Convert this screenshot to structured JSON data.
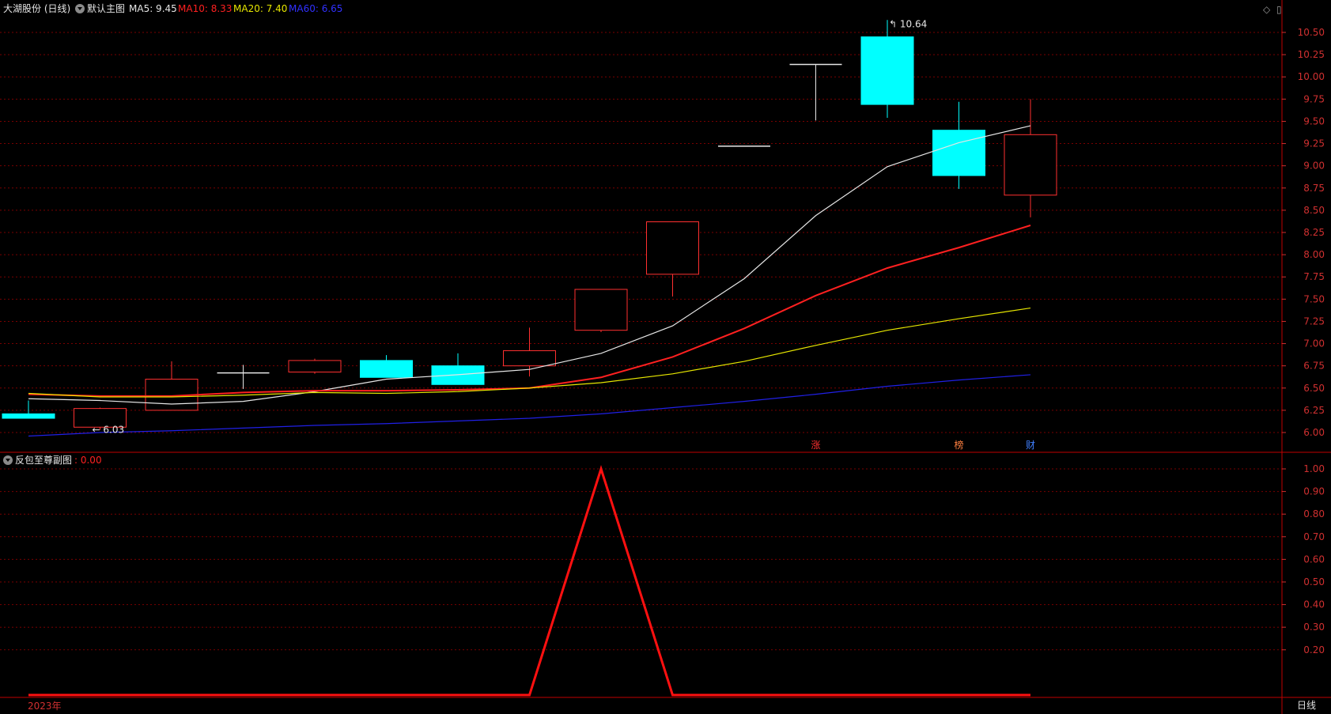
{
  "header": {
    "stock_name": "大湖股份 (日线)",
    "main_chart_label": "默认主图",
    "ma5": "MA5: 9.45",
    "ma10": "MA10: 8.33",
    "ma20": "MA20: 7.40",
    "ma60": "MA60: 6.65",
    "dropdown_icon": "chevron-down-icon",
    "window_controls": [
      "diamond-icon",
      "window-icon"
    ]
  },
  "subchart": {
    "label": "反包至尊副图",
    "value": ": 0.00"
  },
  "colors": {
    "ma5": "#e6e6e6",
    "ma10": "#ff2020",
    "ma20": "#e6e600",
    "ma60": "#2020e6",
    "up": "#ff3030",
    "down": "#00ffff",
    "grid": "#7a0000",
    "axis_text": "#d03030",
    "background": "#000000"
  },
  "footer": {
    "year_label": "2023年",
    "period_label": "日线"
  },
  "price_markers": {
    "low_label": "6.03",
    "high_label": "10.64"
  },
  "event_tags": [
    "涨",
    "榜",
    "财"
  ],
  "chart_data": [
    {
      "type": "candlestick",
      "title": "",
      "y_ticks": [
        "10.50",
        "10.25",
        "10.00",
        "9.75",
        "9.50",
        "9.25",
        "9.00",
        "8.75",
        "8.50",
        "8.25",
        "8.00",
        "7.75",
        "7.50",
        "7.25",
        "7.00",
        "6.75",
        "6.50",
        "6.25",
        "6.00"
      ],
      "ylim": [
        5.97,
        10.72
      ],
      "candles": [
        {
          "open": 6.21,
          "close": 6.16,
          "high": 6.36,
          "low": 6.16
        },
        {
          "open": 6.06,
          "close": 6.27,
          "high": 6.28,
          "low": 6.03
        },
        {
          "open": 6.25,
          "close": 6.6,
          "high": 6.8,
          "low": 6.25
        },
        {
          "open": 6.67,
          "close": 6.67,
          "high": 6.76,
          "low": 6.49
        },
        {
          "open": 6.68,
          "close": 6.81,
          "high": 6.83,
          "low": 6.66
        },
        {
          "open": 6.81,
          "close": 6.62,
          "high": 6.87,
          "low": 6.62
        },
        {
          "open": 6.75,
          "close": 6.54,
          "high": 6.89,
          "low": 6.54
        },
        {
          "open": 6.75,
          "close": 6.92,
          "high": 7.18,
          "low": 6.63
        },
        {
          "open": 7.15,
          "close": 7.61,
          "high": 7.61,
          "low": 7.13
        },
        {
          "open": 7.78,
          "close": 8.37,
          "high": 8.37,
          "low": 7.53
        },
        {
          "open": 9.22,
          "close": 9.22,
          "high": 9.22,
          "low": 9.22
        },
        {
          "open": 10.14,
          "close": 10.14,
          "high": 10.14,
          "low": 9.51
        },
        {
          "open": 10.45,
          "close": 9.69,
          "high": 10.64,
          "low": 9.54
        },
        {
          "open": 9.4,
          "close": 8.89,
          "high": 9.72,
          "low": 8.74
        },
        {
          "open": 8.67,
          "close": 9.35,
          "high": 9.75,
          "low": 8.42
        }
      ],
      "series": [
        {
          "name": "MA5",
          "values": [
            6.38,
            6.36,
            6.32,
            6.35,
            6.46,
            6.6,
            6.65,
            6.71,
            6.89,
            7.2,
            7.73,
            8.44,
            8.99,
            9.26,
            9.45
          ]
        },
        {
          "name": "MA10",
          "values": [
            6.43,
            6.41,
            6.41,
            6.45,
            6.47,
            6.47,
            6.48,
            6.5,
            6.62,
            6.85,
            7.17,
            7.54,
            7.85,
            8.08,
            8.33
          ]
        },
        {
          "name": "MA20",
          "values": [
            6.44,
            6.4,
            6.4,
            6.42,
            6.45,
            6.44,
            6.46,
            6.5,
            6.56,
            6.66,
            6.8,
            6.98,
            7.15,
            7.28,
            7.4
          ]
        },
        {
          "name": "MA60",
          "values": [
            5.96,
            6.0,
            6.02,
            6.05,
            6.08,
            6.1,
            6.13,
            6.16,
            6.21,
            6.28,
            6.35,
            6.43,
            6.52,
            6.59,
            6.65
          ]
        }
      ]
    },
    {
      "type": "line",
      "title": "",
      "y_ticks": [
        "1.00",
        "0.90",
        "0.80",
        "0.70",
        "0.60",
        "0.50",
        "0.40",
        "0.30",
        "0.20"
      ],
      "ylim": [
        -0.02,
        1.03
      ],
      "series": [
        {
          "name": "反包至尊副图",
          "values": [
            0,
            0,
            0,
            0,
            0,
            0,
            0,
            0,
            1,
            0,
            0,
            0,
            0,
            0,
            0
          ]
        }
      ]
    }
  ]
}
